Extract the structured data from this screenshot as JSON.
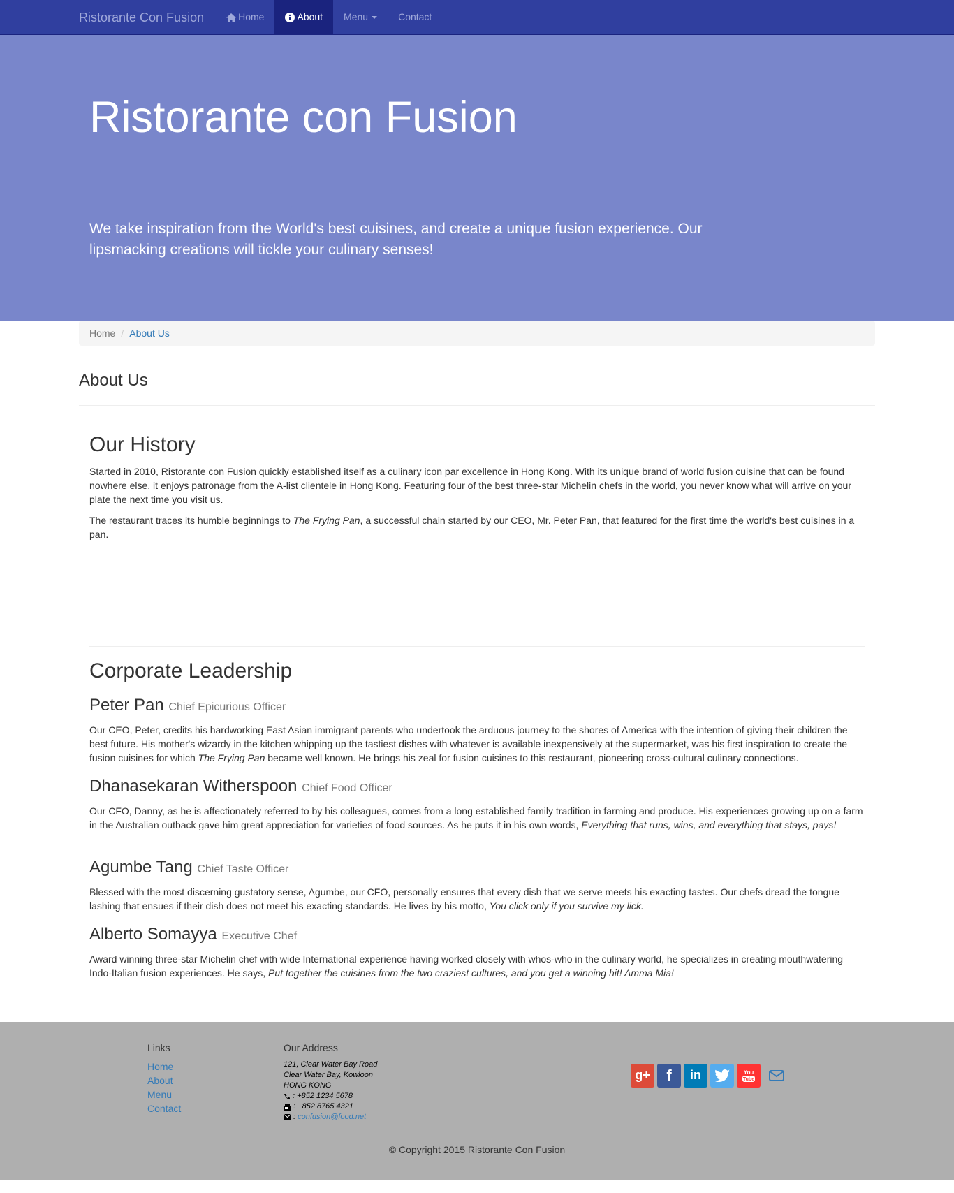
{
  "navbar": {
    "brand": "Ristorante Con Fusion",
    "items": [
      {
        "label": "Home",
        "icon": "home-icon"
      },
      {
        "label": "About",
        "icon": "info-sign-icon",
        "active": true
      },
      {
        "label": "Menu",
        "icon": "caret-down-icon"
      },
      {
        "label": "Contact"
      }
    ],
    "colors": {
      "bar": "#303f9f",
      "active": "#1a237e",
      "text": "#9fa8da"
    }
  },
  "jumbotron": {
    "title": "Ristorante con Fusion",
    "text": "We take inspiration from the World's best cuisines, and create a unique fusion experience. Our lipsmacking creations will tickle your culinary senses!",
    "background": "#7986cb"
  },
  "breadcrumb": {
    "home": "Home",
    "active": "About Us",
    "separator": "/"
  },
  "page": {
    "heading": "About Us",
    "history": {
      "title": "Our History",
      "p1": "Started in 2010, Ristorante con Fusion quickly established itself as a culinary icon par excellence in Hong Kong. With its unique brand of world fusion cuisine that can be found nowhere else, it enjoys patronage from the A-list clientele in Hong Kong. Featuring four of the best three-star Michelin chefs in the world, you never know what will arrive on your plate the next time you visit us.",
      "p2_before": "The restaurant traces its humble beginnings to ",
      "p2_em": "The Frying Pan",
      "p2_after": ", a successful chain started by our CEO, Mr. Peter Pan, that featured for the first time the world's best cuisines in a pan."
    },
    "leadership": {
      "title": "Corporate Leadership",
      "leaders": [
        {
          "name": "Peter Pan",
          "role": "Chief Epicurious Officer",
          "bio_before": "Our CEO, Peter, credits his hardworking East Asian immigrant parents who undertook the arduous journey to the shores of America with the intention of giving their children the best future. His mother's wizardy in the kitchen whipping up the tastiest dishes with whatever is available inexpensively at the supermarket, was his first inspiration to create the fusion cuisines for which ",
          "bio_em": "The Frying Pan",
          "bio_after": " became well known. He brings his zeal for fusion cuisines to this restaurant, pioneering cross-cultural culinary connections."
        },
        {
          "name": "Dhanasekaran Witherspoon",
          "role": "Chief Food Officer",
          "bio_before": "Our CFO, Danny, as he is affectionately referred to by his colleagues, comes from a long established family tradition in farming and produce. His experiences growing up on a farm in the Australian outback gave him great appreciation for varieties of food sources. As he puts it in his own words, ",
          "bio_em": "Everything that runs, wins, and everything that stays, pays!",
          "bio_after": ""
        },
        {
          "name": "Agumbe Tang",
          "role": "Chief Taste Officer",
          "bio_before": "Blessed with the most discerning gustatory sense, Agumbe, our CFO, personally ensures that every dish that we serve meets his exacting tastes. Our chefs dread the tongue lashing that ensues if their dish does not meet his exacting standards. He lives by his motto, ",
          "bio_em": "You click only if you survive my lick.",
          "bio_after": ""
        },
        {
          "name": "Alberto Somayya",
          "role": "Executive Chef",
          "bio_before": "Award winning three-star Michelin chef with wide International experience having worked closely with whos-who in the culinary world, he specializes in creating mouthwatering Indo-Italian fusion experiences. He says, ",
          "bio_em": "Put together the cuisines from the two craziest cultures, and you get a winning hit! Amma Mia!",
          "bio_after": ""
        }
      ]
    }
  },
  "footer": {
    "links_heading": "Links",
    "links": [
      "Home",
      "About",
      "Menu",
      "Contact"
    ],
    "address_heading": "Our Address",
    "address_lines": [
      "121, Clear Water Bay Road",
      "Clear Water Bay, Kowloon",
      "HONG KONG"
    ],
    "phone": ": +852 1234 5678",
    "fax": ": +852 8765 4321",
    "email": "confusion@food.net",
    "social": [
      "google-plus-icon",
      "facebook-icon",
      "linkedin-icon",
      "twitter-icon",
      "youtube-icon",
      "envelope-icon"
    ],
    "copyright": "© Copyright 2015 Ristorante Con Fusion",
    "background": "#afafaf"
  }
}
